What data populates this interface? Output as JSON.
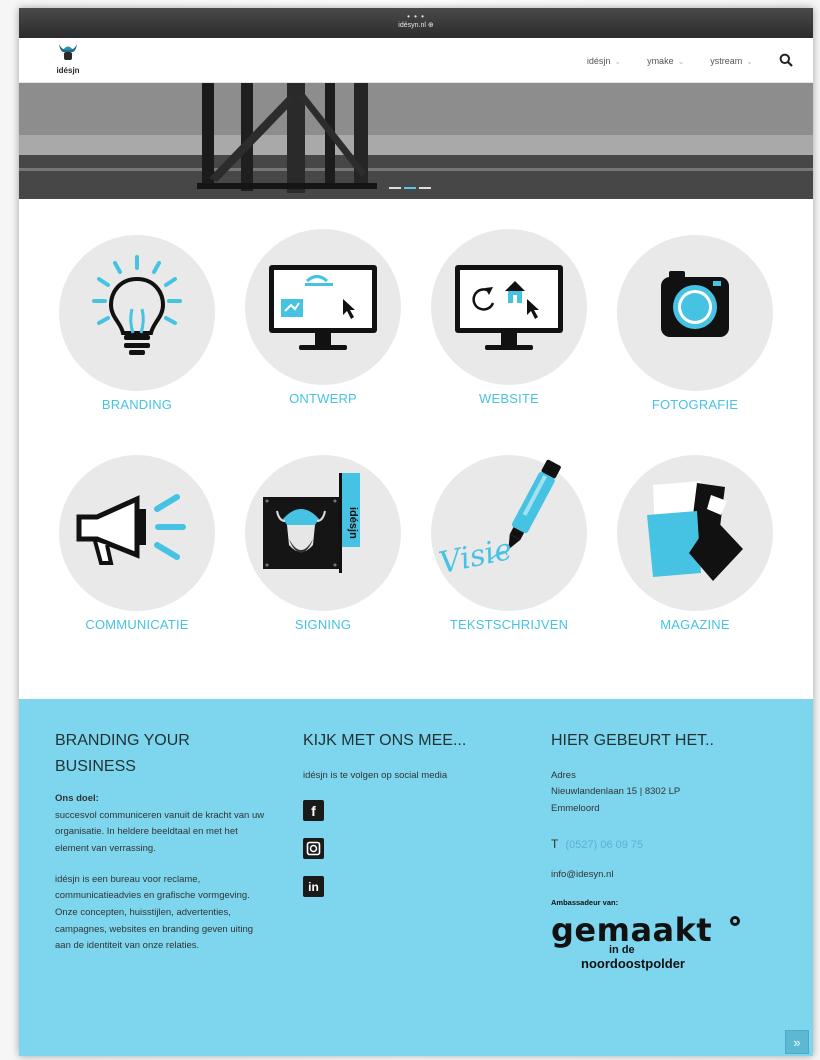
{
  "browser": {
    "dots": "• • •",
    "title": "idésyn.nl ⊕"
  },
  "header": {
    "logo_text": "idésjn",
    "nav": [
      {
        "label": "idésjn"
      },
      {
        "label": "ymake"
      },
      {
        "label": "ystream"
      }
    ],
    "search_icon": "search-icon"
  },
  "services": [
    {
      "label": "BRANDING",
      "icon": "lightbulb-icon"
    },
    {
      "label": "ONTWERP",
      "icon": "monitor-design-icon"
    },
    {
      "label": "WEBSITE",
      "icon": "monitor-website-icon"
    },
    {
      "label": "FOTOGRAFIE",
      "icon": "camera-icon"
    },
    {
      "label": "COMMUNICATIE",
      "icon": "megaphone-icon"
    },
    {
      "label": "SIGNING",
      "icon": "flag-sign-icon"
    },
    {
      "label": "TEKSTSCHRIJVEN",
      "icon": "pen-icon"
    },
    {
      "label": "MAGAZINE",
      "icon": "papers-icon"
    }
  ],
  "signing_flag_text": "idésjn",
  "pen_word": "Visie",
  "footer": {
    "col1": {
      "heading": "BRANDING YOUR BUSINESS",
      "goal_label": "Ons doel:",
      "goal_text": "succesvol communiceren vanuit de kracht van uw organisatie. In heldere beeldtaal en met het element van verrassing.",
      "about_text": "idésjn is een bureau voor reclame, communicatieadvies en grafische vormgeving. Onze concepten, huisstijlen, advertenties, campagnes, websites en branding geven uiting aan de identiteit van onze relaties."
    },
    "col2": {
      "heading": "KIJK MET ONS MEE...",
      "text": "idésjn is te volgen op social media",
      "social": [
        {
          "icon": "facebook-icon",
          "glyph": "f"
        },
        {
          "icon": "instagram-icon",
          "glyph": ""
        },
        {
          "icon": "linkedin-icon",
          "glyph": "in"
        }
      ]
    },
    "col3": {
      "heading": "HIER GEBEURT HET..",
      "address_label": "Adres",
      "address_line1": "Nieuwlandenlaan 15 | 8302 LP",
      "address_line2": "Emmeloord",
      "phone_prefix": "T",
      "phone": "(0527) 06 09 75",
      "email": "info@idesyn.nl",
      "ambassador_label": "Ambassadeur van:",
      "gemaakt_word": "gemaakt",
      "gemaakt_sub1": "in de",
      "gemaakt_sub2": "noordoostpolder"
    },
    "scroll_top": "»"
  },
  "colors": {
    "accent": "#46c3e3",
    "footer_bg": "#7dd6ee",
    "circle": "#e9e9e9"
  }
}
